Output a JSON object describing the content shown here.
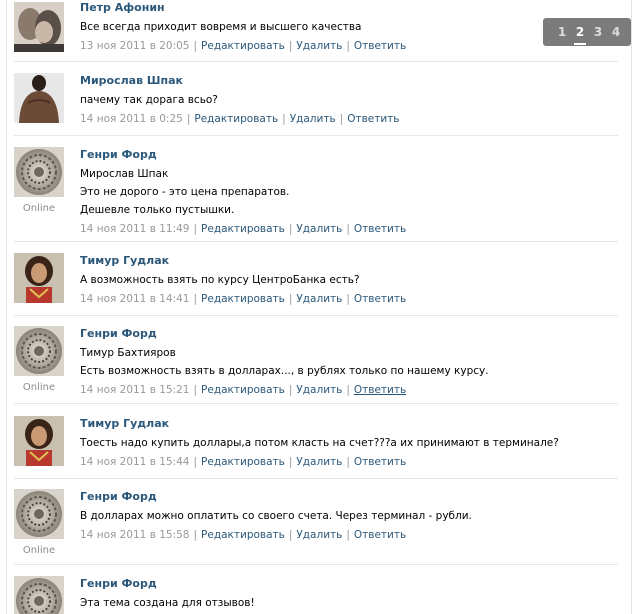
{
  "pager": {
    "pages": [
      "1",
      "2",
      "3",
      "4"
    ],
    "current_index": 1
  },
  "comments": [
    {
      "author": "Петр Афонин",
      "lines": [
        "Все всегда приходит вовремя и высшего качества"
      ],
      "date": "13 ноя 2011 в 20:05",
      "online": "",
      "avatar": "avatar-couple"
    },
    {
      "author": "Мирослав Шпак",
      "lines": [
        "пачему так дорага всьо?"
      ],
      "date": "14 ноя 2011 в 0:25",
      "online": "",
      "avatar": "avatar-man-back"
    },
    {
      "author": "Генри Форд",
      "lines": [
        "Мирослав Шпак",
        "Это не дорого - это цена препаратов.",
        "Дешевле только пустышки."
      ],
      "date": "14 ноя 2011 в 11:49",
      "online": "Online",
      "avatar": "avatar-ornament"
    },
    {
      "author": "Тимур Гудлак",
      "lines": [
        "А возможность взять по курсу ЦентроБанка есть?"
      ],
      "date": "14 ноя 2011 в 14:41",
      "online": "",
      "avatar": "avatar-person"
    },
    {
      "author": "Генри Форд",
      "lines": [
        "Тимур Бахтияров",
        "Есть возможность взять в долларах..., в рублях только по нашему курсу."
      ],
      "date": "14 ноя 2011 в 15:21",
      "online": "Online",
      "avatar": "avatar-ornament"
    },
    {
      "author": "Тимур Гудлак",
      "lines": [
        "Тоесть надо купить доллары,а потом класть на счет???а их принимают в терминале?"
      ],
      "date": "14 ноя 2011 в 15:44",
      "online": "",
      "avatar": "avatar-person"
    },
    {
      "author": "Генри Форд",
      "lines": [
        "В долларах можно оплатить со своего счета. Через терминал - рубли."
      ],
      "date": "14 ноя 2011 в 15:58",
      "online": "Online",
      "avatar": "avatar-ornament"
    },
    {
      "author": "Генри Форд",
      "lines": [
        "Эта тема создана для отзывов!"
      ],
      "date": "",
      "online": "",
      "avatar": "avatar-ornament"
    }
  ],
  "actions": {
    "edit": "Редактировать",
    "delete": "Удалить",
    "reply": "Ответить"
  },
  "colors": {
    "link": "#2b587a",
    "meta": "#999999",
    "separator": "#e4e8ee",
    "pager_bg": "#7b7b7b"
  }
}
